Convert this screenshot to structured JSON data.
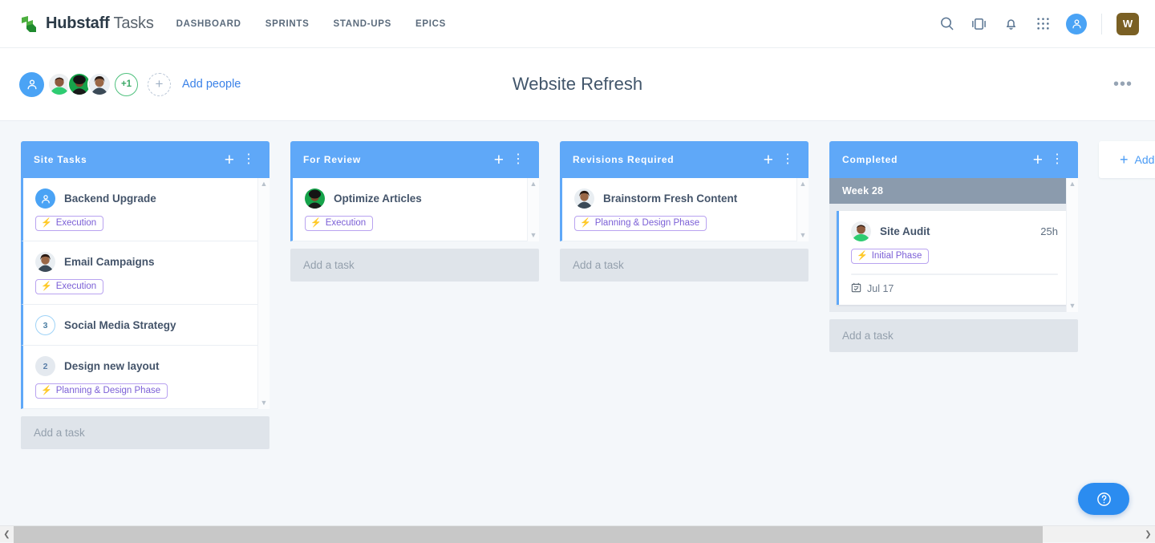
{
  "topnav": {
    "brand_bold": "Hubstaff",
    "brand_light": "Tasks",
    "logo_icon": "hubstaff-logo-icon",
    "links": [
      {
        "label": "Dashboard"
      },
      {
        "label": "Sprints"
      },
      {
        "label": "Stand-ups"
      },
      {
        "label": "Epics"
      }
    ],
    "icons": [
      {
        "name": "search-icon"
      },
      {
        "name": "sidebar-panel-icon"
      },
      {
        "name": "notification-bell-icon"
      },
      {
        "name": "apps-grid-icon"
      }
    ],
    "account_avatar_icon": "user-avatar-icon",
    "workspace_badge": "W",
    "workspace_badge_color": "#7a6024"
  },
  "project_header": {
    "title": "Website Refresh",
    "overflow_label": "•••",
    "people": [
      {
        "name": "team-avatar-icon",
        "type": "icon"
      },
      {
        "name": "member-avatar-1",
        "type": "photo"
      },
      {
        "name": "member-avatar-2",
        "type": "photo"
      },
      {
        "name": "member-avatar-3",
        "type": "photo"
      }
    ],
    "overflow_count": "+1",
    "add_icon": "plus-icon",
    "add_people_label": "Add people"
  },
  "board": {
    "add_task_placeholder": "Add a task",
    "add_column_label": "Add",
    "add_column_icon": "plus-icon",
    "column_accent": "#5fa8f8",
    "tag_color": "#7b5fd6",
    "columns": [
      {
        "title": "Site Tasks",
        "add_icon": "plus-icon",
        "menu_icon": "kebab-menu-icon",
        "scrollable": true,
        "cards": [
          {
            "title": "Backend Upgrade",
            "lead": {
              "kind": "avatar-icon",
              "value": "user-avatar-icon"
            },
            "tag": "Execution"
          },
          {
            "title": "Email Campaigns",
            "lead": {
              "kind": "photo",
              "value": "member-avatar-3"
            },
            "tag": "Execution"
          },
          {
            "title": "Social Media Strategy",
            "lead": {
              "kind": "count-ring",
              "value": "3"
            },
            "tag": ""
          },
          {
            "title": "Design new layout",
            "lead": {
              "kind": "count-solid",
              "value": "2"
            },
            "tag": "Planning & Design Phase"
          }
        ]
      },
      {
        "title": "For Review",
        "add_icon": "plus-icon",
        "menu_icon": "kebab-menu-icon",
        "scrollable": true,
        "cards": [
          {
            "title": "Optimize Articles",
            "lead": {
              "kind": "photo",
              "value": "member-avatar-2"
            },
            "tag": "Execution"
          }
        ]
      },
      {
        "title": "Revisions Required",
        "add_icon": "plus-icon",
        "menu_icon": "kebab-menu-icon",
        "scrollable": true,
        "cards": [
          {
            "title": "Brainstorm Fresh Content",
            "lead": {
              "kind": "photo",
              "value": "member-avatar-3"
            },
            "tag": "Planning & Design Phase"
          }
        ]
      },
      {
        "title": "Completed",
        "add_icon": "plus-icon",
        "menu_icon": "kebab-menu-icon",
        "scrollable": true,
        "group": {
          "label": "Week 28",
          "card": {
            "title": "Site Audit",
            "hours": "25h",
            "lead": {
              "kind": "photo",
              "value": "member-avatar-1"
            },
            "tag": "Initial Phase",
            "due_icon": "calendar-check-icon",
            "due_date": "Jul 17"
          }
        }
      }
    ]
  },
  "footer": {
    "scroll_left_icon": "chevron-left-icon",
    "scroll_right_icon": "chevron-right-icon"
  },
  "help": {
    "icon": "question-mark-icon"
  }
}
